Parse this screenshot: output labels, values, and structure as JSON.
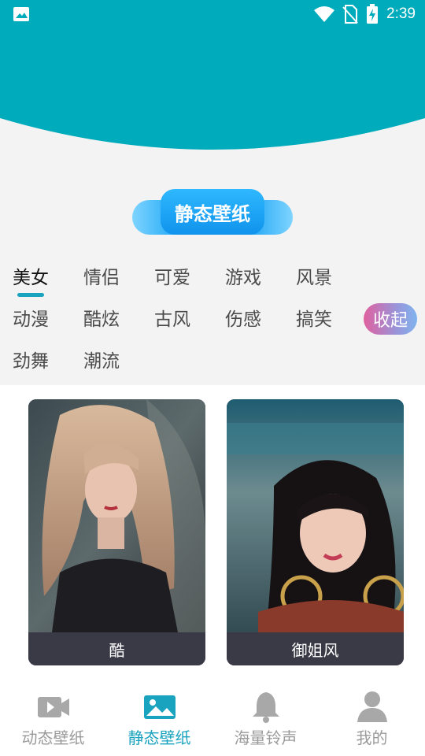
{
  "status_bar": {
    "time": "2:39",
    "icons": [
      "image-icon",
      "wifi-icon",
      "no-sim-icon",
      "battery-charging-icon"
    ]
  },
  "page_title": "静态壁纸",
  "categories": {
    "active_index": 0,
    "items": [
      "美女",
      "情侣",
      "可爱",
      "游戏",
      "风景",
      "动漫",
      "酷炫",
      "古风",
      "伤感",
      "搞笑",
      "劲舞",
      "潮流"
    ],
    "collapse_label": "收起"
  },
  "wallpapers": [
    {
      "caption": "酷"
    },
    {
      "caption": "御姐风"
    }
  ],
  "bottom_nav": {
    "active_index": 1,
    "items": [
      {
        "label": "动态壁纸",
        "icon": "video-camera-icon"
      },
      {
        "label": "静态壁纸",
        "icon": "picture-icon"
      },
      {
        "label": "海量铃声",
        "icon": "bell-icon"
      },
      {
        "label": "我的",
        "icon": "person-icon"
      }
    ]
  },
  "colors": {
    "header": "#00abbc",
    "accent": "#1aa3be",
    "title_pill": "#15a0f2",
    "caption_bg": "#3a3946",
    "inactive_nav": "#9a9a9a"
  }
}
